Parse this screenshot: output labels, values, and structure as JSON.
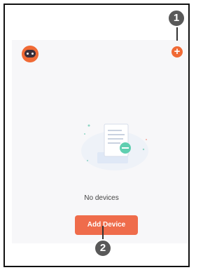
{
  "header": {
    "avatar_icon": "robot-avatar-icon",
    "add_icon_label": "+"
  },
  "empty_state": {
    "illustration_icon": "empty-document-icon",
    "message": "No devices"
  },
  "actions": {
    "add_device_label": "Add Device"
  },
  "annotations": {
    "callout_1": "1",
    "callout_2": "2"
  },
  "colors": {
    "accent": "#ef6c4b",
    "background": "#f7f7f9",
    "teal": "#5fcfb0"
  }
}
